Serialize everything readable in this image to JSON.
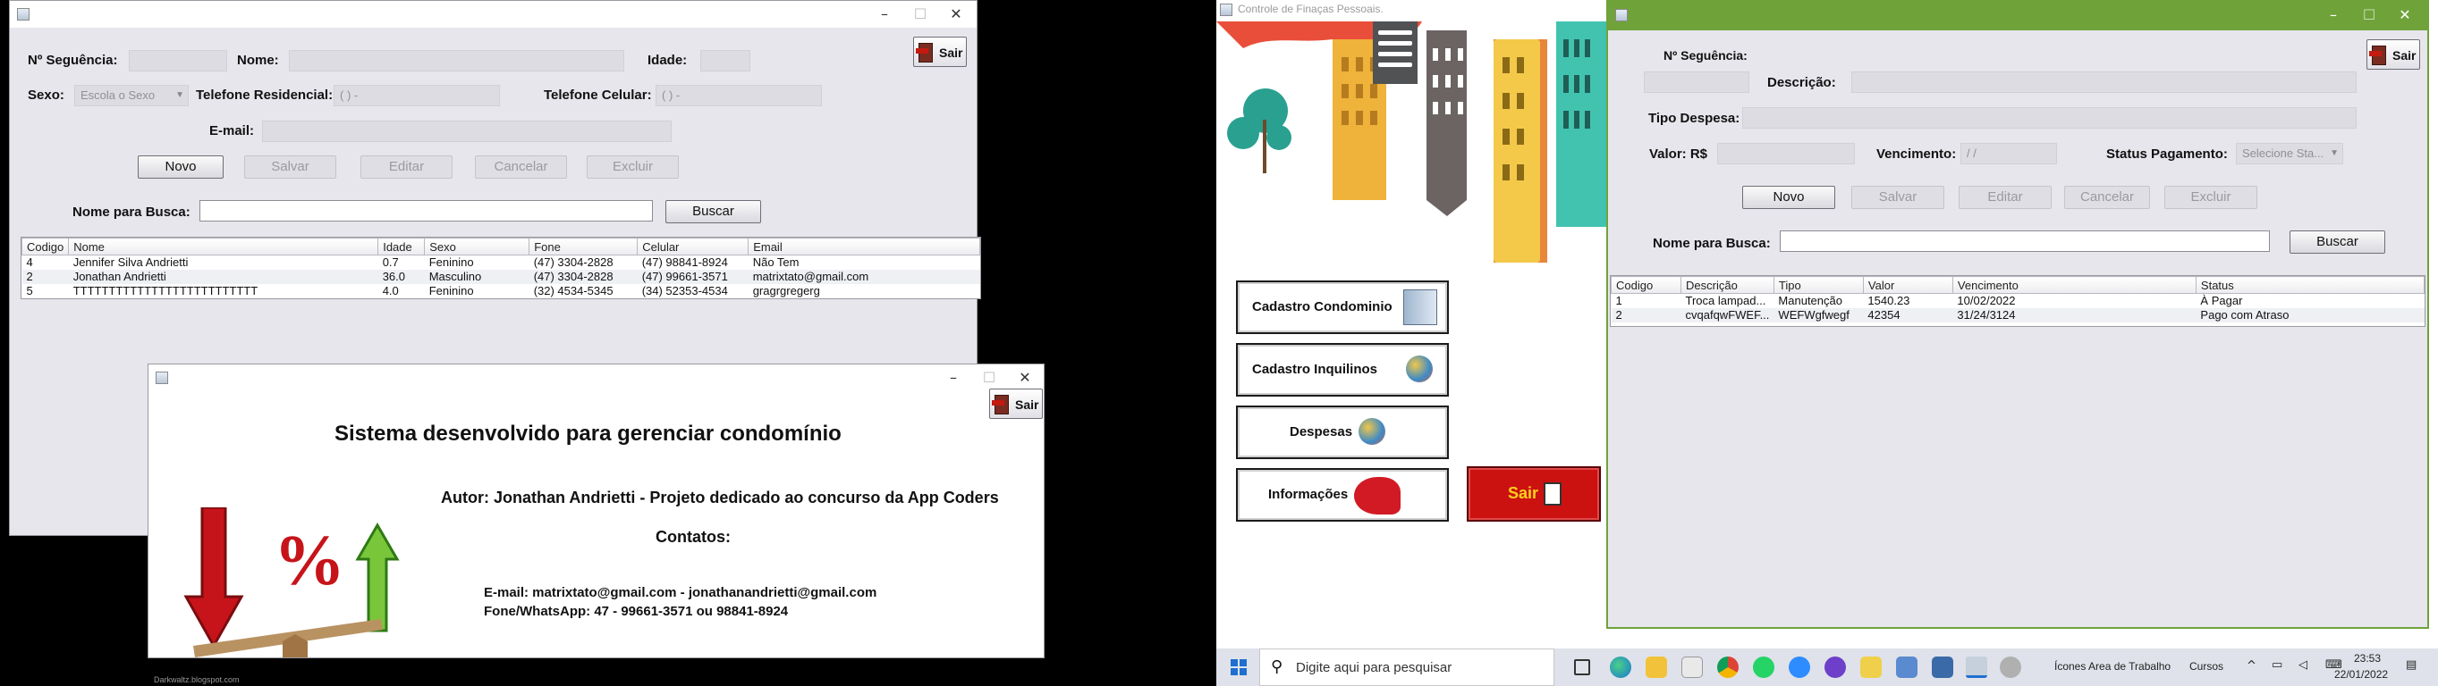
{
  "colors": {
    "accent_green": "#6fa33a",
    "exit_red": "#cc1111",
    "blogspot": "#9a9aa0"
  },
  "left_window": {
    "labels": {
      "seq": "Nº Seguência:",
      "nome": "Nome:",
      "idade": "Idade:",
      "sexo": "Sexo:",
      "tel_res": "Telefone Residencial:",
      "tel_cel": "Telefone Celular:",
      "email": "E-mail:",
      "busca": "Nome para Busca:"
    },
    "sexo_value": "Escola o Sexo",
    "tel_res_mask": "(  )    -",
    "tel_cel_mask": "(  )    -",
    "buttons": {
      "novo": "Novo",
      "salvar": "Salvar",
      "editar": "Editar",
      "cancelar": "Cancelar",
      "excluir": "Excluir",
      "buscar": "Buscar",
      "sair": "Sair"
    },
    "table": {
      "headers": [
        "Codigo",
        "Nome",
        "Idade",
        "Sexo",
        "Fone",
        "Celular",
        "Email"
      ],
      "rows": [
        [
          "4",
          "Jennifer Silva Andrietti",
          "0.7",
          "Feninino",
          "(47) 3304-2828",
          "(47) 98841-8924",
          "Não Tem"
        ],
        [
          "2",
          "Jonathan Andrietti",
          "36.0",
          "Masculino",
          "(47) 3304-2828",
          "(47) 99661-3571",
          "matrixtato@gmail.com"
        ],
        [
          "5",
          "TTTTTTTTTTTTTTTTTTTTTTTTTT",
          "4.0",
          "Feninino",
          "(32) 4534-5345",
          "(34) 52353-4534",
          "gragrgregerg"
        ]
      ]
    }
  },
  "about_window": {
    "heading": "Sistema desenvolvido para gerenciar condomínio",
    "author": "Autor: Jonathan Andrietti - Projeto dedicado ao concurso da App Coders",
    "contacts_title": "Contatos:",
    "email_line": "E-mail: matrixtato@gmail.com - jonathanandrietti@gmail.com",
    "phone_line": "Fone/WhatsApp: 47 - 99661-3571 ou 98841-8924",
    "sair": "Sair",
    "percent": "%"
  },
  "blog_watermark": "Darkwaltz.blogspot.com",
  "main_window": {
    "title": "Controle de Finaças Pessoais.",
    "menu": [
      "Cadastro Condominio",
      "Cadastro Inquilinos",
      "Despesas",
      "Informações"
    ],
    "sair": "Sair"
  },
  "despesas_window": {
    "labels": {
      "seq": "Nº Seguência:",
      "descricao": "Descrição:",
      "tipo": "Tipo Despesa:",
      "valor": "Valor: R$",
      "vencimento": "Vencimento:",
      "status": "Status Pagamento:",
      "busca": "Nome para Busca:"
    },
    "vencimento_mask": "  /  /",
    "status_value": "Selecione Sta...",
    "buttons": {
      "novo": "Novo",
      "salvar": "Salvar",
      "editar": "Editar",
      "cancelar": "Cancelar",
      "excluir": "Excluir",
      "buscar": "Buscar",
      "sair": "Sair"
    },
    "table": {
      "headers": [
        "Codigo",
        "Descrição",
        "Tipo",
        "Valor",
        "Vencimento",
        "Status"
      ],
      "rows": [
        [
          "1",
          "Troca lampad...",
          "Manutenção",
          "1540.23",
          "10/02/2022",
          "À Pagar"
        ],
        [
          "2",
          "cvqafqwFWEF...",
          "WEFWgfwegf",
          "42354",
          "31/24/3124",
          "Pago com Atraso"
        ]
      ]
    }
  },
  "taskbar": {
    "search_placeholder": "Digite aqui para pesquisar",
    "toolbar1": "Ícones Area de Trabalho",
    "toolbar2": "Cursos",
    "time": "23:53",
    "date": "22/01/2022"
  }
}
